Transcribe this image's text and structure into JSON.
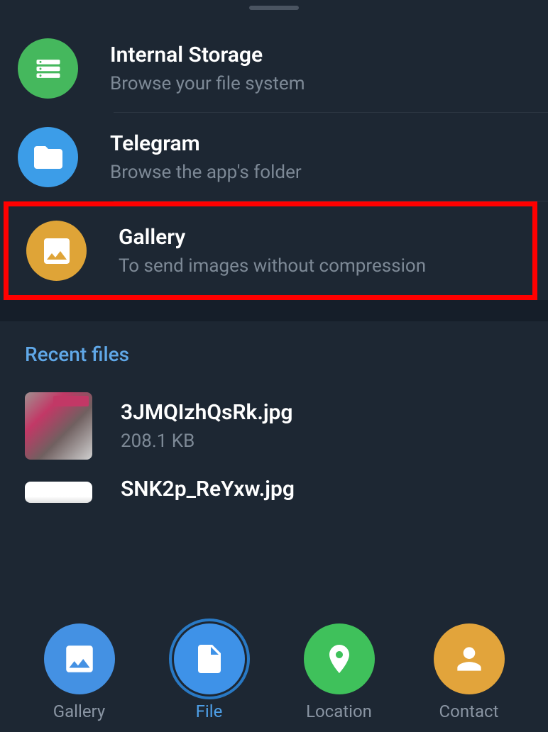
{
  "sources": {
    "internal_storage": {
      "title": "Internal Storage",
      "subtitle": "Browse your file system",
      "icon": "storage-icon",
      "color": "green"
    },
    "telegram": {
      "title": "Telegram",
      "subtitle": "Browse the app's folder",
      "icon": "folder-icon",
      "color": "blue"
    },
    "gallery": {
      "title": "Gallery",
      "subtitle": "To send images without compression",
      "icon": "image-icon",
      "color": "yellow"
    }
  },
  "recent": {
    "header": "Recent files",
    "files": [
      {
        "name": "3JMQIzhQsRk.jpg",
        "size": "208.1 KB"
      },
      {
        "name": "SNK2p_ReYxw.jpg",
        "size": ""
      }
    ]
  },
  "nav": {
    "gallery": "Gallery",
    "file": "File",
    "location": "Location",
    "contact": "Contact"
  }
}
